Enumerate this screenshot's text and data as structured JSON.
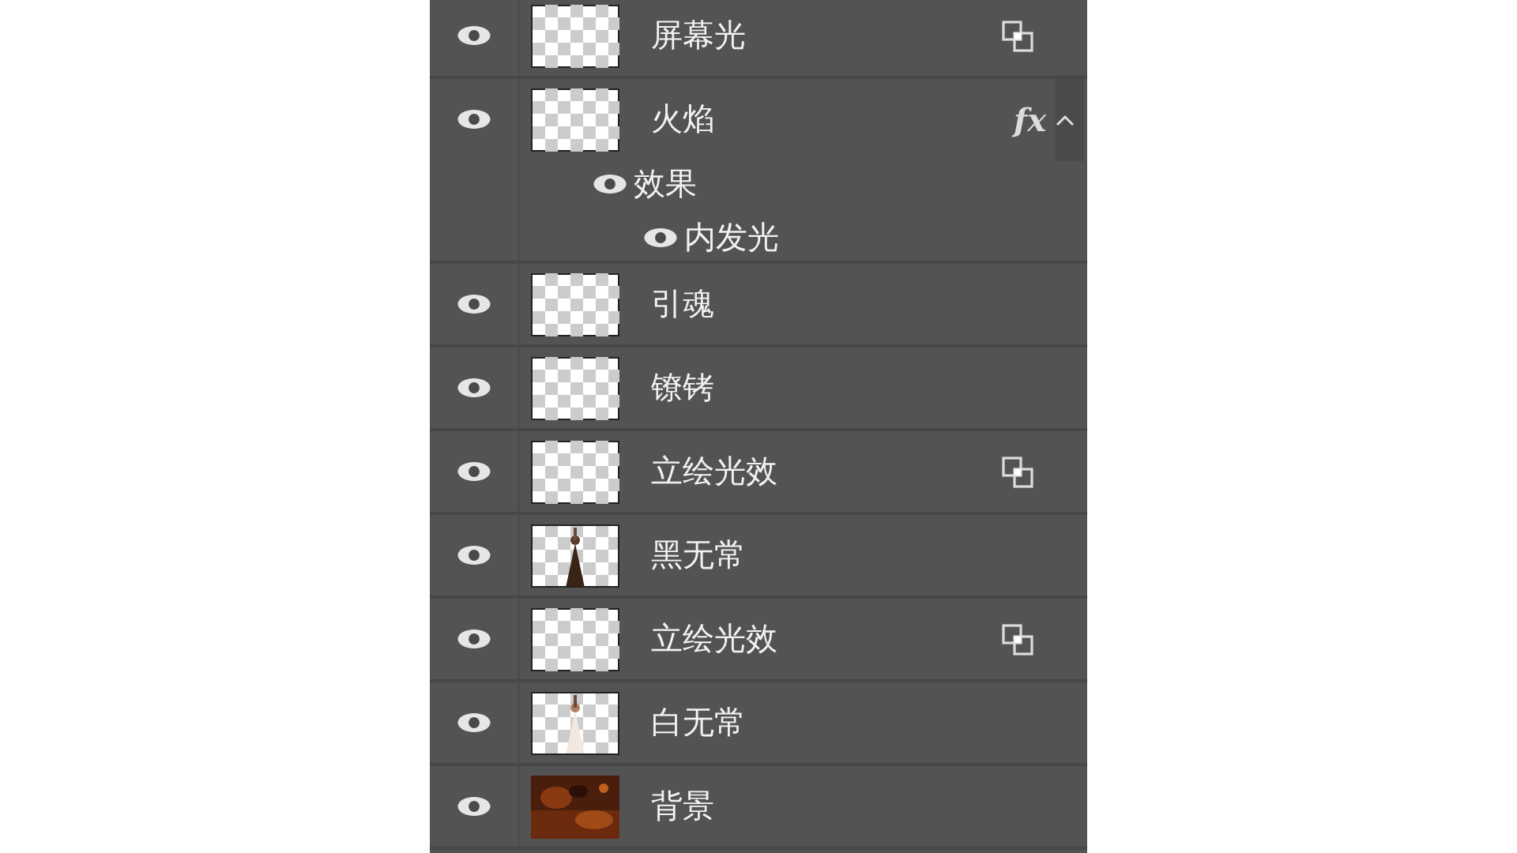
{
  "layers": [
    {
      "name": "屏幕光",
      "visible": true,
      "thumbnail": {
        "kind": "transparent"
      },
      "badge": {
        "kind": "smart-object"
      }
    },
    {
      "name": "火焰",
      "visible": true,
      "thumbnail": {
        "kind": "transparent"
      },
      "badge": {
        "kind": "fx",
        "text": "fx"
      },
      "expanded": true,
      "effects": [
        {
          "name": "效果",
          "visible": true,
          "children": [
            {
              "name": "内发光",
              "visible": true
            }
          ]
        }
      ]
    },
    {
      "name": "引魂",
      "visible": true,
      "thumbnail": {
        "kind": "transparent"
      }
    },
    {
      "name": "镣铐",
      "visible": true,
      "thumbnail": {
        "kind": "transparent"
      }
    },
    {
      "name": "立绘光效",
      "visible": true,
      "thumbnail": {
        "kind": "transparent"
      },
      "badge": {
        "kind": "smart-object"
      }
    },
    {
      "name": "黑无常",
      "visible": true
    },
    {
      "name": "立绘光效",
      "visible": true,
      "thumbnail": {
        "kind": "transparent"
      },
      "badge": {
        "kind": "smart-object"
      }
    },
    {
      "name": "白无常",
      "visible": true
    },
    {
      "name": "背景",
      "visible": true
    }
  ]
}
